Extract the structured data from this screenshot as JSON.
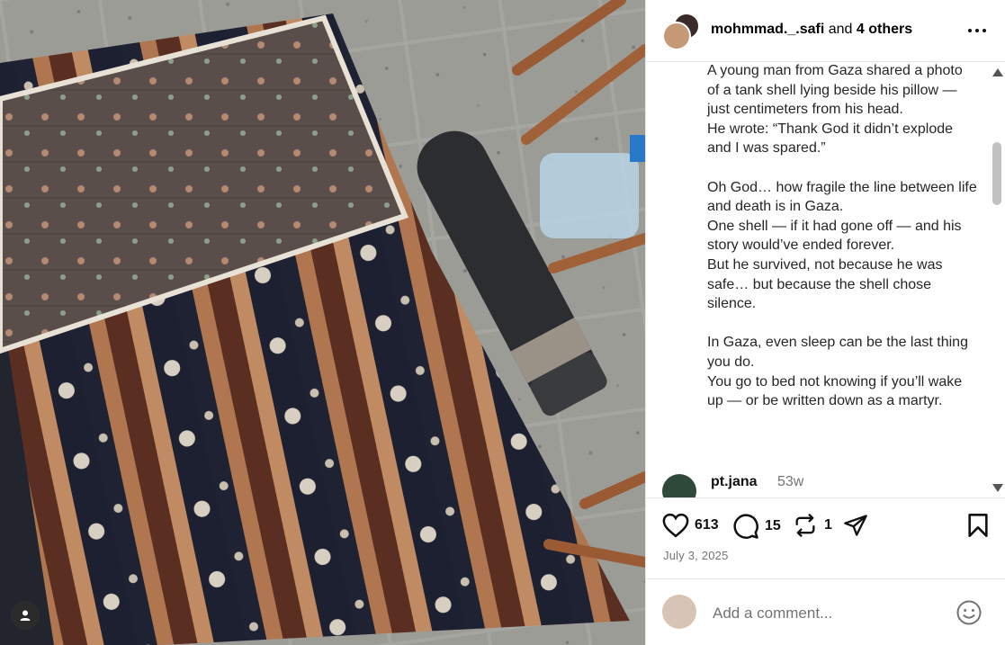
{
  "post": {
    "author": "mohmmad._.safi",
    "coauthors_joiner": "and",
    "coauthors": "4 others",
    "date": "July 3, 2025"
  },
  "caption": {
    "lines": [
      "A young man from Gaza shared a photo of a tank shell lying beside his pillow — just centimeters from his head.",
      "He wrote: “Thank God it didn’t explode and I was spared.”",
      "",
      "Oh God… how fragile the line between life and death is in Gaza.",
      "One shell — if it had gone off — and his story would’ve ended forever.",
      "But he survived, not because he was safe… but because the shell chose silence.",
      "",
      "In Gaza, even sleep can be the last thing you do.",
      "You go to bed not knowing if you’ll wake up — or be written down as a martyr."
    ]
  },
  "comments": [
    {
      "user": "pt.jana",
      "time": "53w"
    }
  ],
  "stats": {
    "likes": "613",
    "comments": "15",
    "reposts": "1"
  },
  "add_comment": {
    "placeholder": "Add a comment..."
  },
  "icons": {
    "like": "heart-icon",
    "comment": "speech-bubble-icon",
    "repost": "repost-icon",
    "share": "paper-plane-icon",
    "save": "bookmark-icon",
    "more": "ellipsis-icon",
    "emoji": "smiley-icon",
    "tag": "person-icon"
  }
}
